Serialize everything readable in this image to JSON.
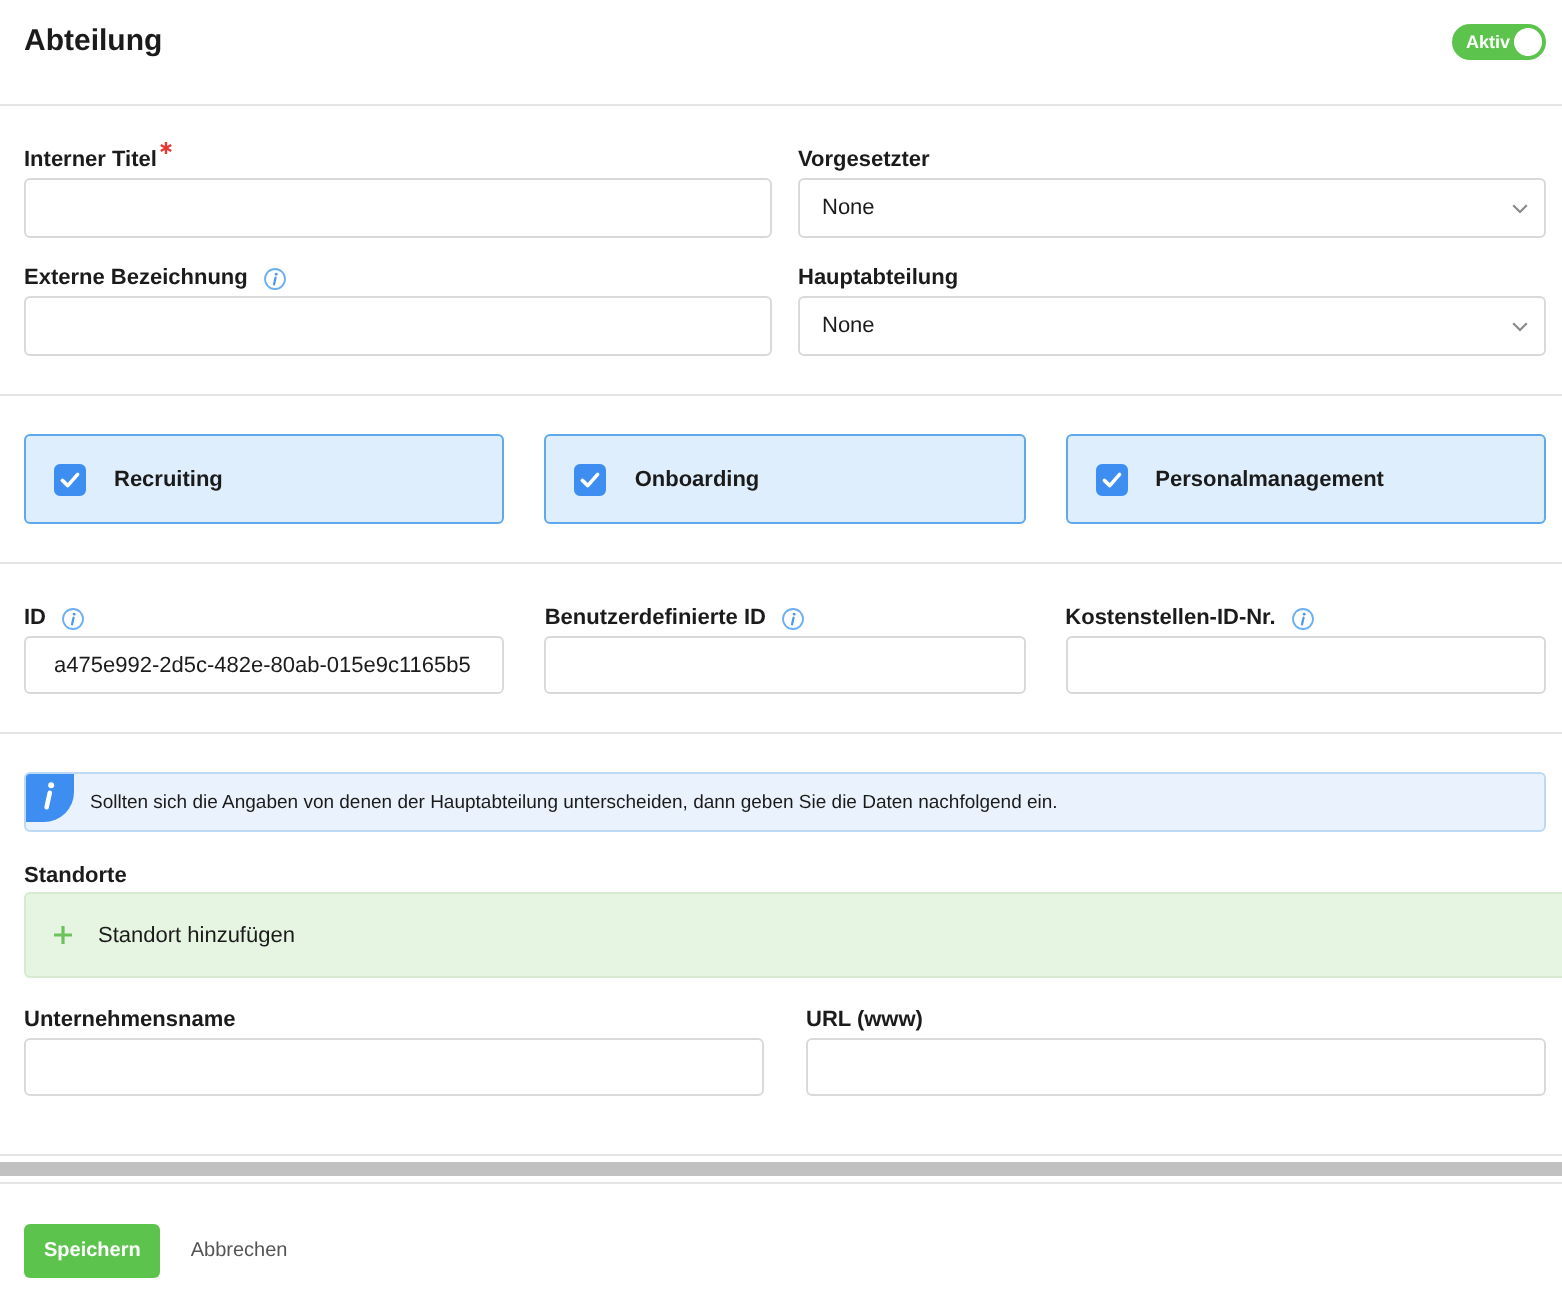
{
  "header": {
    "title": "Abteilung",
    "status": {
      "label": "Aktiv",
      "on": true
    }
  },
  "general_fields": [
    {
      "kind": "input",
      "label": "Interner Titel",
      "required": true,
      "info": false
    },
    {
      "kind": "select",
      "label": "Vorgesetzter",
      "value": "None",
      "required": false,
      "info": false
    },
    {
      "kind": "input",
      "label": "Externe Bezeichnung",
      "required": false,
      "info": true
    },
    {
      "kind": "select",
      "label": "Hauptabteilung",
      "value": "None",
      "required": false,
      "info": false
    }
  ],
  "modules": [
    {
      "label": "Recruiting",
      "checked": true
    },
    {
      "label": "Onboarding",
      "checked": true
    },
    {
      "label": "Personalmanagement",
      "checked": true
    }
  ],
  "id_fields": [
    {
      "label": "ID",
      "info": true,
      "value": "a475e992-2d5c-482e-80ab-015e9c1165b5"
    },
    {
      "label": "Benutzerdefinierte ID",
      "info": true
    },
    {
      "label": "Kostenstellen-ID-Nr.",
      "info": true
    }
  ],
  "notice": {
    "text": "Sollten sich die Angaben von denen der Hauptabteilung unterscheiden, dann geben Sie die Daten nachfolgend ein."
  },
  "locations": {
    "label": "Standorte",
    "add_button": "Standort hinzufügen"
  },
  "company_fields": [
    {
      "label": "Unternehmensname"
    },
    {
      "label": "URL (www)"
    }
  ],
  "actions": {
    "save": "Speichern",
    "cancel": "Abbrechen"
  }
}
